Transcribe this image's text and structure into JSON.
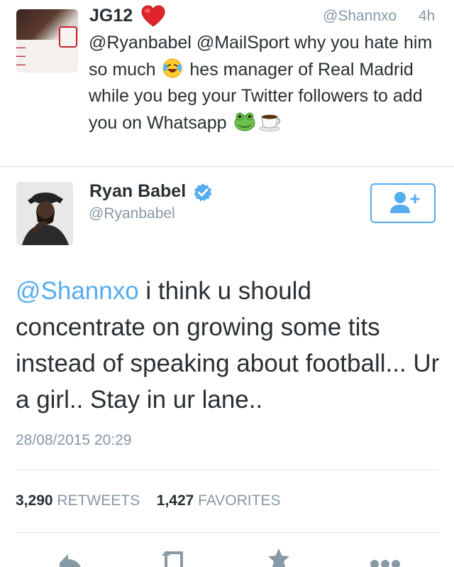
{
  "parent_tweet": {
    "name": "JG12",
    "handle": "@Shannxo",
    "time": "4h",
    "text_parts": [
      "@Ryanbabel @MailSport why you hate him so much ",
      " hes manager of Real Madrid while you beg your Twitter followers to add you on Whatsapp "
    ],
    "emojis": [
      "heart-emoji",
      "laughing-crying-emoji",
      "frog-emoji",
      "coffee-emoji"
    ]
  },
  "main_tweet": {
    "name": "Ryan Babel",
    "handle": "@Ryanbabel",
    "verified": true,
    "mention": "@Shannxo",
    "text": " i think u should concentrate on growing some tits instead of speaking about football... Ur a girl.. Stay in ur lane..",
    "date": "28/08/2015 20:29",
    "retweets_count": "3,290",
    "retweets_label": "RETWEETS",
    "favorites_count": "1,427",
    "favorites_label": "FAVORITES"
  },
  "colors": {
    "accent": "#55acee",
    "text": "#292f33",
    "muted": "#8899a6",
    "divider": "#dfe3e6",
    "heart": "#e0242b"
  },
  "icons": [
    "heart-emoji",
    "verified-badge-icon",
    "follow-user-icon",
    "reply-icon",
    "retweet-icon",
    "favorite-icon",
    "more-icon"
  ]
}
